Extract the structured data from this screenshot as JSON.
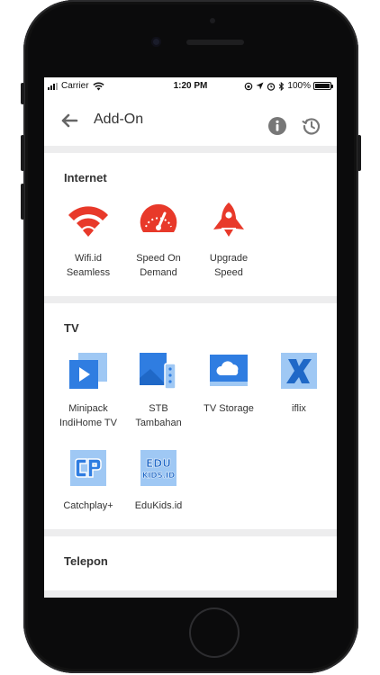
{
  "statusbar": {
    "carrier": "Carrier",
    "time": "1:20 PM",
    "battery": "100%"
  },
  "header": {
    "title": "Add-On"
  },
  "sections": [
    {
      "title": "Internet",
      "items": [
        {
          "label": "Wifi.id\nSeamless",
          "icon": "wifi-icon"
        },
        {
          "label": "Speed On\nDemand",
          "icon": "speedometer-icon"
        },
        {
          "label": "Upgrade\nSpeed",
          "icon": "rocket-icon"
        }
      ]
    },
    {
      "title": "TV",
      "items": [
        {
          "label": "Minipack\nIndiHome TV",
          "icon": "minipack-play-icon"
        },
        {
          "label": "STB\nTambahan",
          "icon": "set-top-box-icon"
        },
        {
          "label": "TV Storage",
          "icon": "cloud-tv-icon"
        },
        {
          "label": "iflix",
          "icon": "iflix-logo-icon"
        },
        {
          "label": "Catchplay+",
          "icon": "catchplay-logo-icon"
        },
        {
          "label": "EduKids.id",
          "icon": "edukids-logo-icon",
          "logo_text": "EDU\nKIDS.ID"
        }
      ]
    },
    {
      "title": "Telepon",
      "items": []
    }
  ],
  "colors": {
    "internet_red": "#e8392a",
    "tv_blue": "#2f7de1",
    "tv_light_blue": "#9fc8f4",
    "text": "#333333",
    "background": "#ededee"
  }
}
